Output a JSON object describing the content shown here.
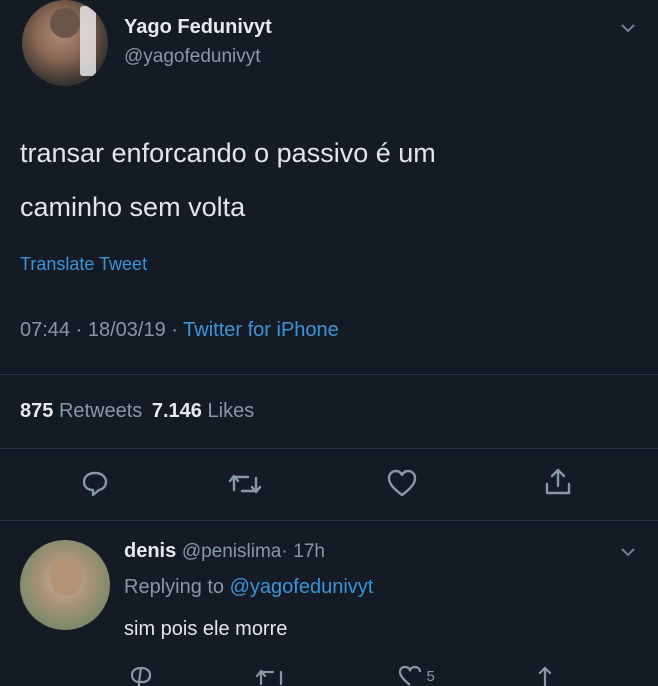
{
  "tweet": {
    "author_name": "Yago Fedunivyt",
    "author_handle": "@yagofedunivyt",
    "text_line1": "transar enforcando o passivo é um",
    "text_line2": "caminho sem volta",
    "translate": "Translate Tweet",
    "time": "07:44",
    "date": "18/03/19",
    "separator": "·",
    "source": "Twitter for iPhone",
    "retweets_count": "875",
    "retweets_label": "Retweets",
    "likes_count": "7.146",
    "likes_label": "Likes"
  },
  "reply": {
    "author_name": "denis",
    "author_handle": "@penislima",
    "separator": "·",
    "time": "17h",
    "replying_prefix": "Replying to",
    "replying_handle": "@yagofedunivyt",
    "text": "sim pois ele morre",
    "like_count": "5"
  },
  "colors": {
    "background": "#141b25",
    "link": "#3b94d9",
    "muted": "#8899a6"
  },
  "icons": [
    "chevron-down-icon",
    "reply-icon",
    "retweet-icon",
    "like-icon",
    "share-icon"
  ]
}
